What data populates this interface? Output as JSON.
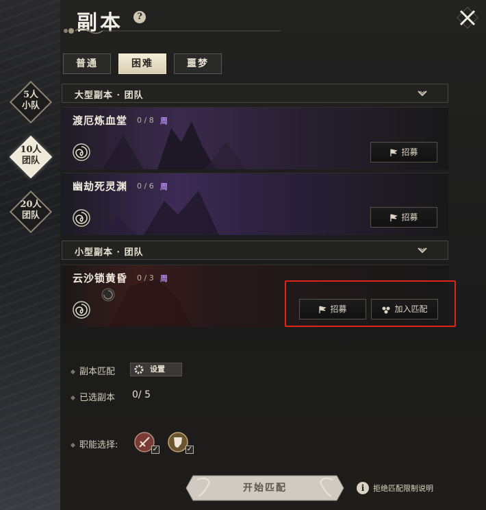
{
  "header": {
    "title": "副本",
    "help_icon": "?",
    "close_icon": "close-icon"
  },
  "difficulty_tabs": [
    {
      "label": "普通",
      "active": false
    },
    {
      "label": "困难",
      "active": true
    },
    {
      "label": "噩梦",
      "active": false
    }
  ],
  "team_size_tabs": [
    {
      "line1": "5人",
      "line2": "小队",
      "active": false
    },
    {
      "line1": "10人",
      "line2": "团队",
      "active": true
    },
    {
      "line1": "20人",
      "line2": "团队",
      "active": false
    }
  ],
  "sections": [
    {
      "title": "大型副本 · 团队",
      "dungeons": [
        {
          "name": "渡厄炼血堂",
          "count": "0 / 8",
          "period": "周",
          "recruit_label": "招募"
        },
        {
          "name": "幽劫死灵渊",
          "count": "0 / 6",
          "period": "周",
          "recruit_label": "招募"
        }
      ]
    },
    {
      "title": "小型副本 · 团队",
      "dungeons": [
        {
          "name": "云沙锁黄昏",
          "count": "0 / 3",
          "period": "周",
          "recruit_label": "招募",
          "join_label": "加入匹配"
        }
      ]
    }
  ],
  "options": {
    "match_label": "副本匹配",
    "settings_label": "设置",
    "selected_label": "已选副本",
    "selected_value": "0/ 5",
    "role_label": "职能选择:"
  },
  "footer": {
    "start_label": "开始匹配",
    "info_icon": "i",
    "info_link": "拒绝匹配限制说明"
  },
  "colors": {
    "accent_purple": "#b48cf0",
    "highlight_red": "#e02418",
    "active_tab": "#efe9d9"
  }
}
